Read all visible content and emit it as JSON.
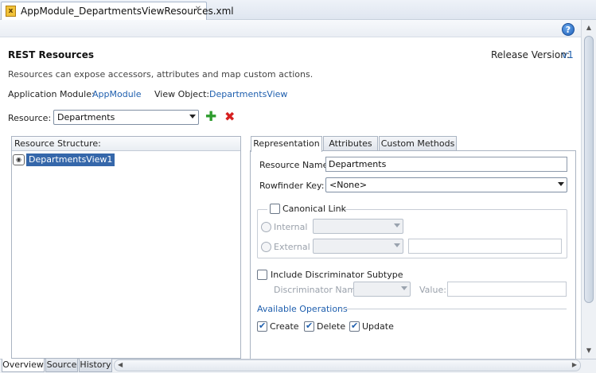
{
  "editor_tab": {
    "filename": "AppModule_DepartmentsViewResources.xml"
  },
  "header": {
    "title": "REST Resources",
    "release_label": "Release Version:",
    "release_value": "v1",
    "description": "Resources can expose accessors, attributes and map custom actions."
  },
  "module_row": {
    "app_module_label": "Application Module:",
    "app_module_value": "AppModule",
    "view_object_label": "View Object:",
    "view_object_value": "DepartmentsView"
  },
  "resource": {
    "label": "Resource:",
    "value": "Departments"
  },
  "structure": {
    "header": "Resource Structure:",
    "node": "DepartmentsView1"
  },
  "tabs": [
    "Representation",
    "Attributes",
    "Custom Methods"
  ],
  "representation": {
    "resource_name_label": "Resource Name:",
    "resource_name_value": "Departments",
    "rowfinder_label": "Rowfinder Key:",
    "rowfinder_value": "<None>",
    "canonical_link_label": "Canonical Link",
    "internal_label": "Internal",
    "external_label": "External",
    "include_discriminator_label": "Include Discriminator Subtype",
    "discriminator_name_label": "Discriminator Name:",
    "value_label": "Value:",
    "available_operations_label": "Available Operations",
    "operations": [
      {
        "label": "Create",
        "checked": true
      },
      {
        "label": "Delete",
        "checked": true
      },
      {
        "label": "Update",
        "checked": true
      }
    ]
  },
  "bottom_tabs": [
    "Overview",
    "Source",
    "History"
  ],
  "icons": {
    "file": "xml-file-icon",
    "help": "help-icon",
    "add": "add-icon",
    "delete": "delete-icon",
    "node": "view-object-icon"
  },
  "colors": {
    "link": "#1f5fae",
    "selection": "#3567aa",
    "add": "#2e9c2e",
    "delete": "#d62020"
  }
}
